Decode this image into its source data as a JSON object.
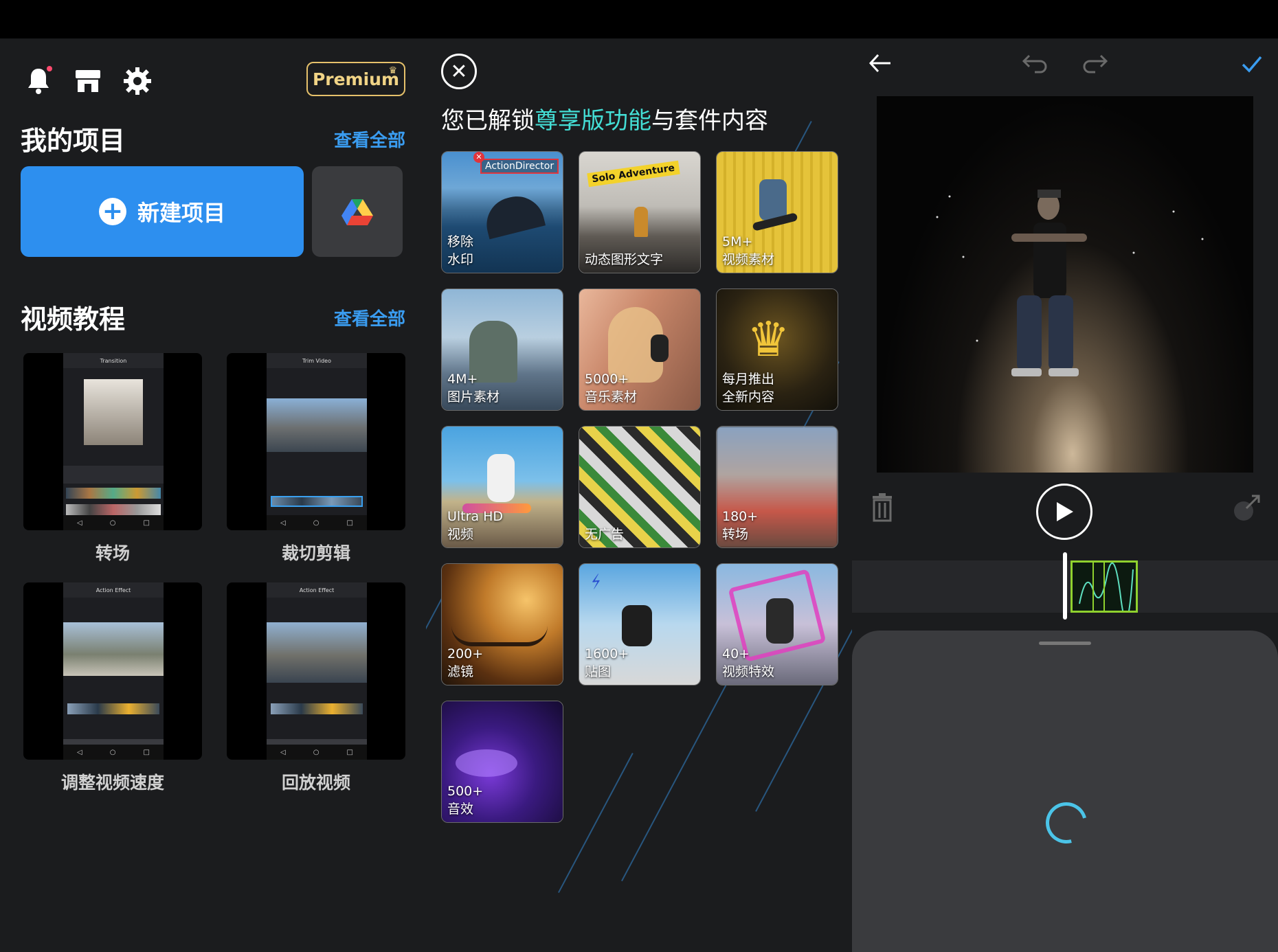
{
  "left": {
    "premium_label": "Premium",
    "my_projects_title": "我的项目",
    "see_all_projects": "查看全部",
    "new_project_label": "新建项目",
    "tutorials_title": "视频教程",
    "see_all_tutorials": "查看全部",
    "tutorials": [
      {
        "label": "转场",
        "screen_title": "Transition"
      },
      {
        "label": "裁切剪辑",
        "screen_title": "Trim Video"
      },
      {
        "label": "调整视频速度",
        "screen_title": "Action Effect"
      },
      {
        "label": "回放视频",
        "screen_title": "Action Effect"
      }
    ]
  },
  "mid": {
    "unlock_prefix": "您已解锁",
    "unlock_highlight": "尊享版功能",
    "unlock_suffix": "与套件内容",
    "tiles": [
      {
        "line1": "移除",
        "line2": "水印",
        "badge": "ActionDirector"
      },
      {
        "line1": "动态图形文字",
        "line2": "",
        "badge": "Solo Adventure"
      },
      {
        "line1": "5M+",
        "line2": "视频素材"
      },
      {
        "line1": "4M+",
        "line2": "图片素材"
      },
      {
        "line1": "5000+",
        "line2": "音乐素材"
      },
      {
        "line1": "每月推出",
        "line2": "全新内容"
      },
      {
        "line1": "Ultra HD",
        "line2": "视频"
      },
      {
        "line1": "无广告",
        "line2": ""
      },
      {
        "line1": "180+",
        "line2": "转场"
      },
      {
        "line1": "200+",
        "line2": "滤镜"
      },
      {
        "line1": "1600+",
        "line2": "贴图"
      },
      {
        "line1": "40+",
        "line2": "视频特效"
      },
      {
        "line1": "500+",
        "line2": "音效"
      }
    ]
  },
  "colors": {
    "accent_blue": "#2d8fef",
    "highlight_teal": "#44dfd6",
    "premium_gold": "#e6c16b",
    "clip_green": "#8fd12e"
  }
}
